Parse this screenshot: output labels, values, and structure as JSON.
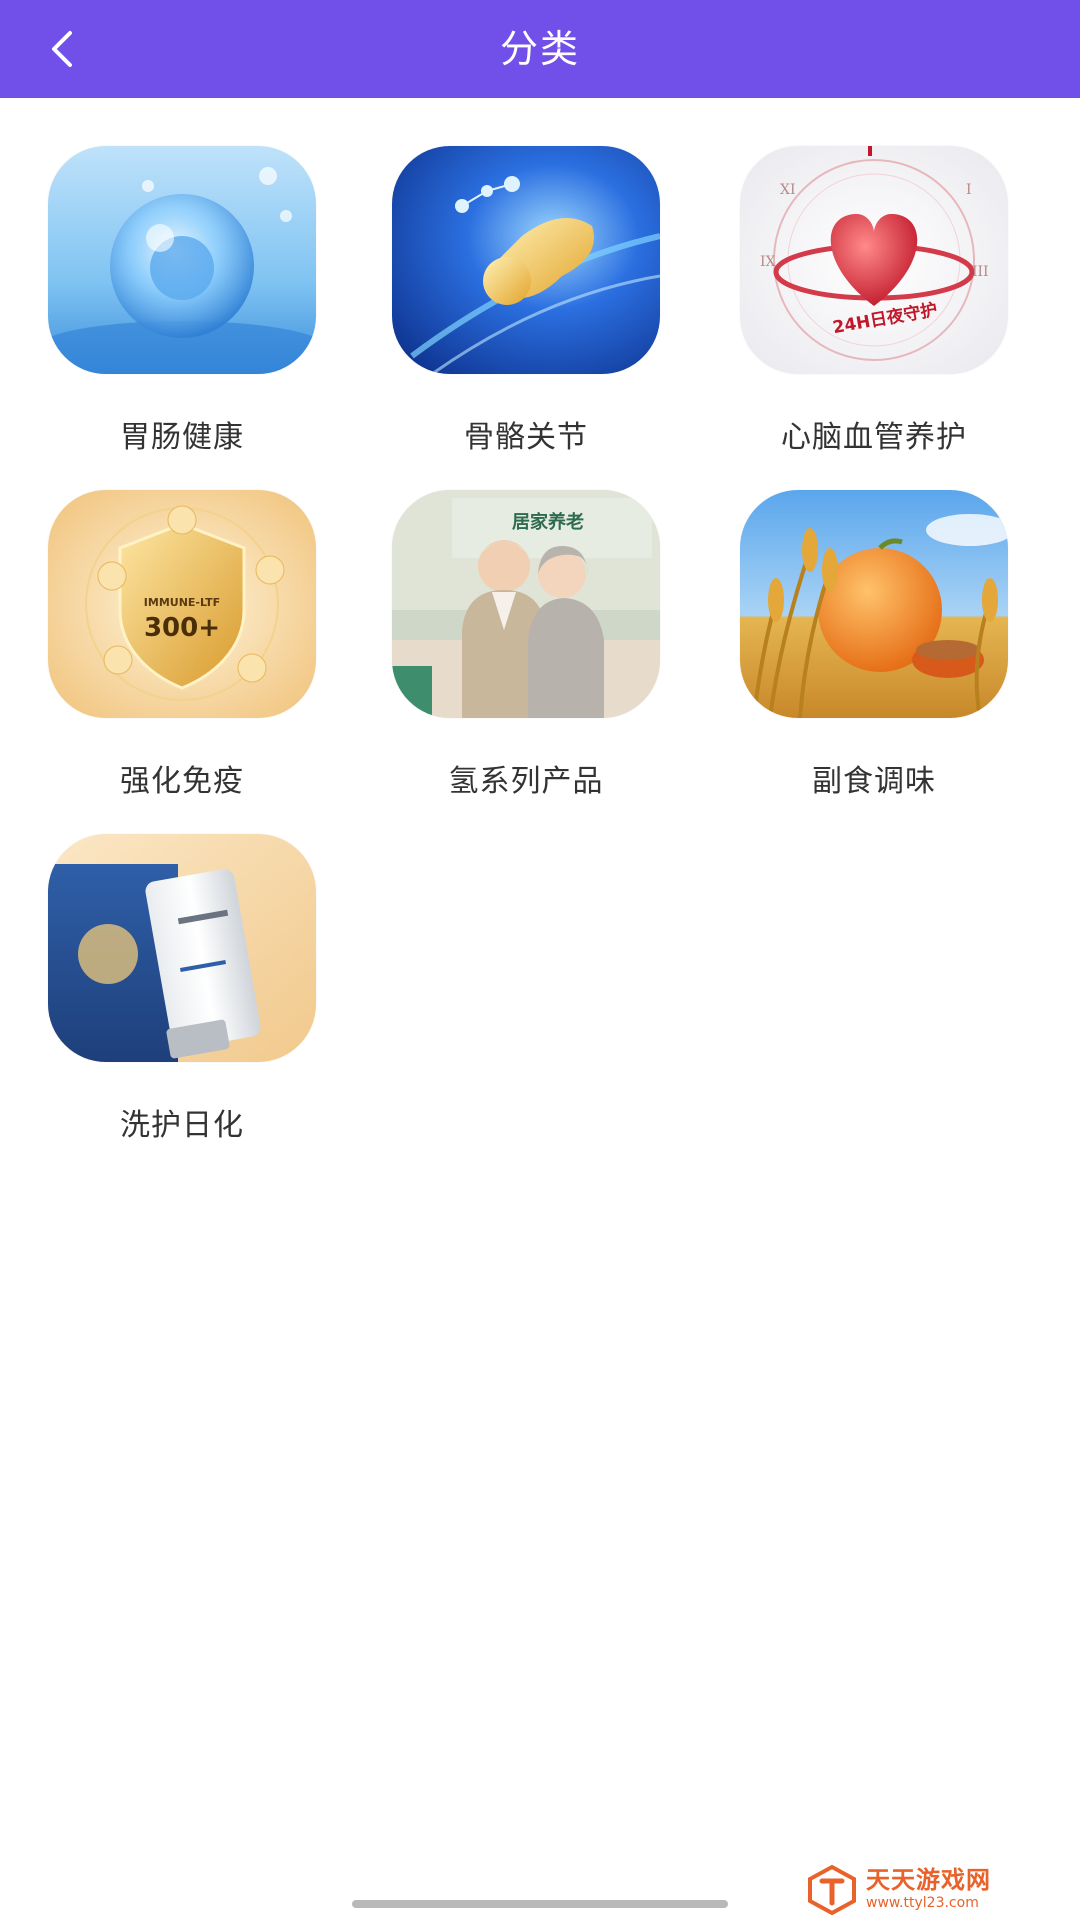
{
  "header": {
    "title": "分类",
    "back_icon": "chevron-left-icon",
    "background_color": "#7150ea"
  },
  "categories": [
    {
      "label": "胃肠健康",
      "image": "water-cell-image"
    },
    {
      "label": "骨骼关节",
      "image": "joint-image"
    },
    {
      "label": "心脑血管养护",
      "image": "heart-clock-image",
      "image_text": "24H日夜守护"
    },
    {
      "label": "强化免疫",
      "image": "shield-image",
      "image_text": "300+"
    },
    {
      "label": "氢系列产品",
      "image": "elderly-couple-image",
      "image_text": "居家养老"
    },
    {
      "label": "副食调味",
      "image": "wheat-pumpkin-image"
    },
    {
      "label": "洗护日化",
      "image": "skincare-products-image"
    }
  ],
  "watermark": {
    "title": "天天游戏网",
    "url": "www.ttyl23.com"
  }
}
